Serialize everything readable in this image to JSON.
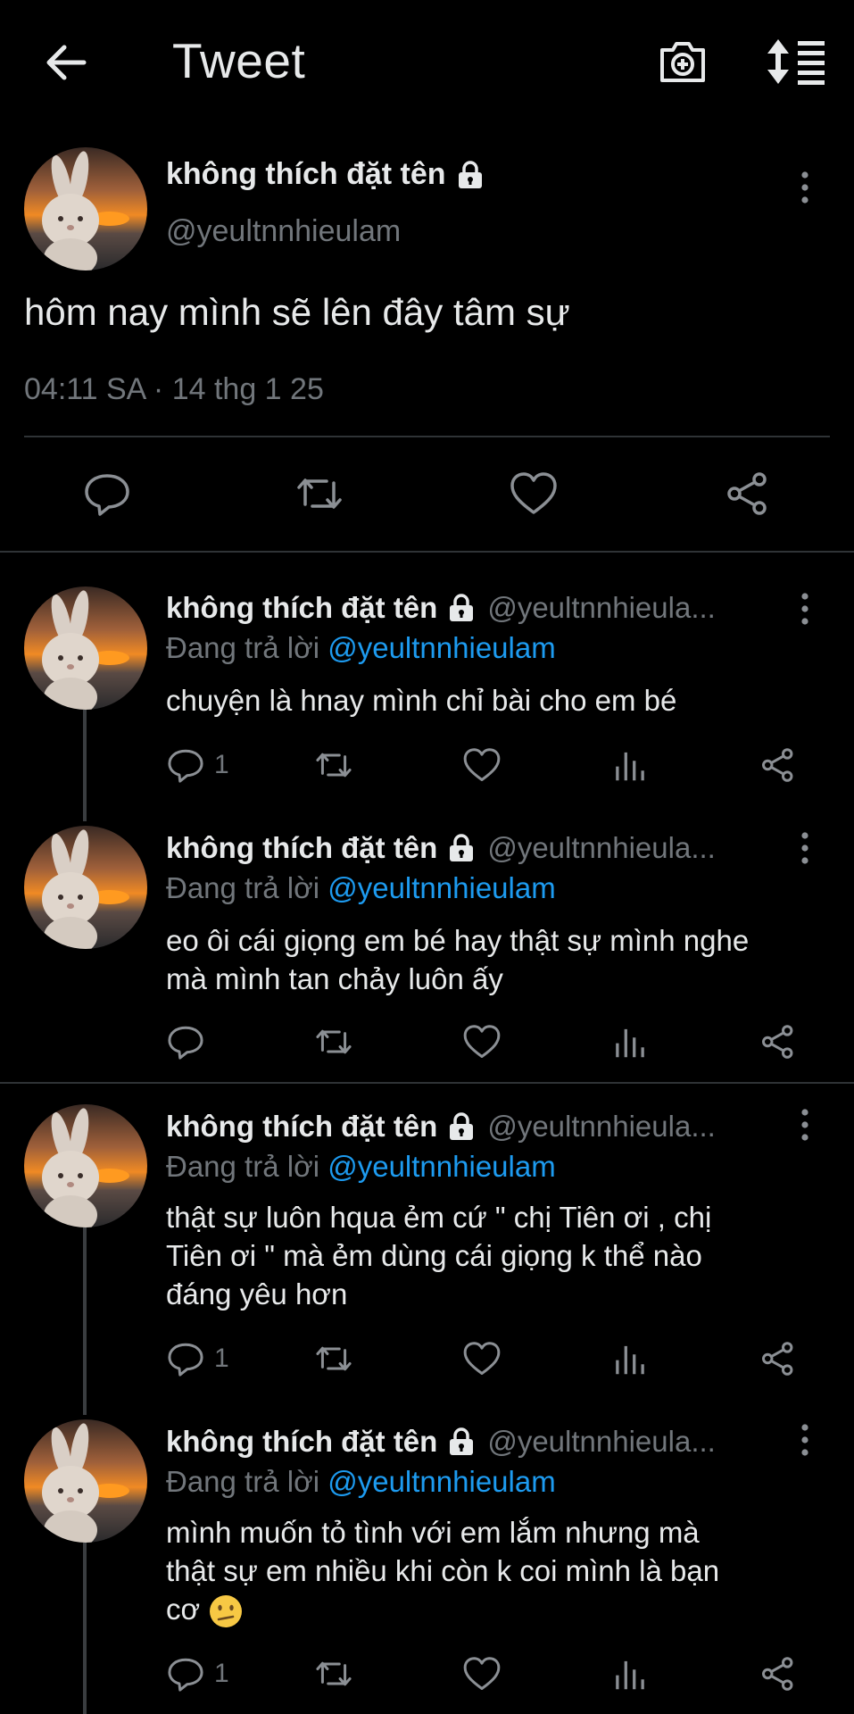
{
  "header": {
    "title": "Tweet",
    "back_icon": "arrow-left-icon",
    "camera_icon": "camera-plus-icon",
    "sort_icon": "sort-icon"
  },
  "main_tweet": {
    "name": "không thích đặt tên",
    "handle": "@yeultnnhieulam",
    "text": "hôm nay mình sẽ lên đây tâm sự",
    "timestamp": "04:11 SA · 14 thg 1 25"
  },
  "replies": [
    {
      "name": "không thích đặt tên",
      "handle": "@yeultnnhieula...",
      "replying_label": "Đang trả lời",
      "replying_to": "@yeultnnhieulam",
      "text_lines": [
        "chuyện là hnay mình chỉ bài cho em bé"
      ],
      "reply_count": "1"
    },
    {
      "name": "không thích đặt tên",
      "handle": "@yeultnnhieula...",
      "replying_label": "Đang trả lời",
      "replying_to": "@yeultnnhieulam",
      "text_lines": [
        "eo ôi cái giọng em bé hay thật sự mình nghe",
        "mà mình tan chảy luôn ấy"
      ],
      "reply_count": ""
    },
    {
      "name": "không thích đặt tên",
      "handle": "@yeultnnhieula...",
      "replying_label": "Đang trả lời",
      "replying_to": "@yeultnnhieulam",
      "text_lines": [
        "thật sự luôn hqua ẻm cứ \" chị Tiên ơi , chị",
        "Tiên ơi \" mà ẻm dùng cái giọng k thể nào",
        "đáng yêu hơn"
      ],
      "reply_count": "1"
    },
    {
      "name": "không thích đặt tên",
      "handle": "@yeultnnhieula...",
      "replying_label": "Đang trả lời",
      "replying_to": "@yeultnnhieulam",
      "text_lines": [
        "mình muốn tỏ tình với em lắm nhưng mà",
        "thật sự em nhiều khi còn k coi mình là bạn",
        "cơ"
      ],
      "reply_count": "1"
    }
  ],
  "colors": {
    "background": "#000000",
    "text": "#e7e9ea",
    "muted": "#71767b",
    "link": "#1d9bf0",
    "divider": "#2f3336"
  }
}
